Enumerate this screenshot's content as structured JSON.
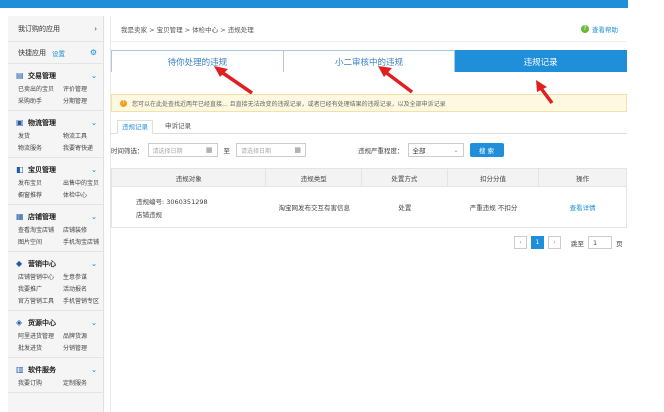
{
  "sidebar": {
    "top_label": "我订购的应用",
    "quick_label": "快捷应用",
    "quick_set": "设置",
    "groups": [
      {
        "title": "交易管理",
        "links": [
          "已卖出的宝贝",
          "评价管理",
          "采购助手",
          "分期管理"
        ]
      },
      {
        "title": "物流管理",
        "links": [
          "发货",
          "物流工具",
          "物流服务",
          "我要寄快递"
        ]
      },
      {
        "title": "宝贝管理",
        "links": [
          "发布宝贝",
          "出售中的宝贝",
          "橱窗推荐",
          "体检中心"
        ]
      },
      {
        "title": "店铺管理",
        "links": [
          "查看淘宝店铺",
          "店铺装修",
          "图片空间",
          "手机淘宝店铺"
        ]
      },
      {
        "title": "营销中心",
        "links": [
          "店铺营销中心",
          "生意参谋",
          "我要推广",
          "活动报名",
          "官方营销工具",
          "手机营销专区"
        ]
      },
      {
        "title": "货源中心",
        "links": [
          "阿里进货管理",
          "品牌货源",
          "批发进货",
          "分销管理"
        ]
      },
      {
        "title": "软件服务",
        "links": [
          "我要订购",
          "定制服务"
        ]
      }
    ]
  },
  "breadcrumb": "我是卖家 > 宝贝管理 > 体检中心 > 违规处理",
  "help_label": "查看帮助",
  "tabs": [
    "待你处理的违规",
    "小二审核中的违规",
    "违规记录"
  ],
  "notice": "您可以在此处查找近两年已经直接... 且直接无法改变的违规记录，或者已经有处理结果的违规记录，以及全部申诉记录",
  "subtabs": [
    "违规记录",
    "申诉记录"
  ],
  "filters": {
    "time_label": "时间筛选：",
    "start_placeholder": "请选择日期",
    "to_label": "至",
    "end_placeholder": "请选择日期",
    "severity_label": "违规严重程度：",
    "severity_value": "全部",
    "search_label": "搜 索"
  },
  "table": {
    "headers": [
      "违规对象",
      "违规类型",
      "处置方式",
      "扣分分值",
      "操作"
    ],
    "rows": [
      {
        "obj_id": "违规编号: 3060351298",
        "obj_name": "店铺违规",
        "type": "淘宝网发布交互有害信息",
        "action": "处置",
        "score": "严重违规 不扣分",
        "op": "查看详情"
      }
    ]
  },
  "pager": {
    "current": "1",
    "goto_label": "跳至",
    "goto_value": "1",
    "page_unit": "页"
  },
  "colors": {
    "accent": "#1e8fd8",
    "arrow": "#e02020"
  }
}
